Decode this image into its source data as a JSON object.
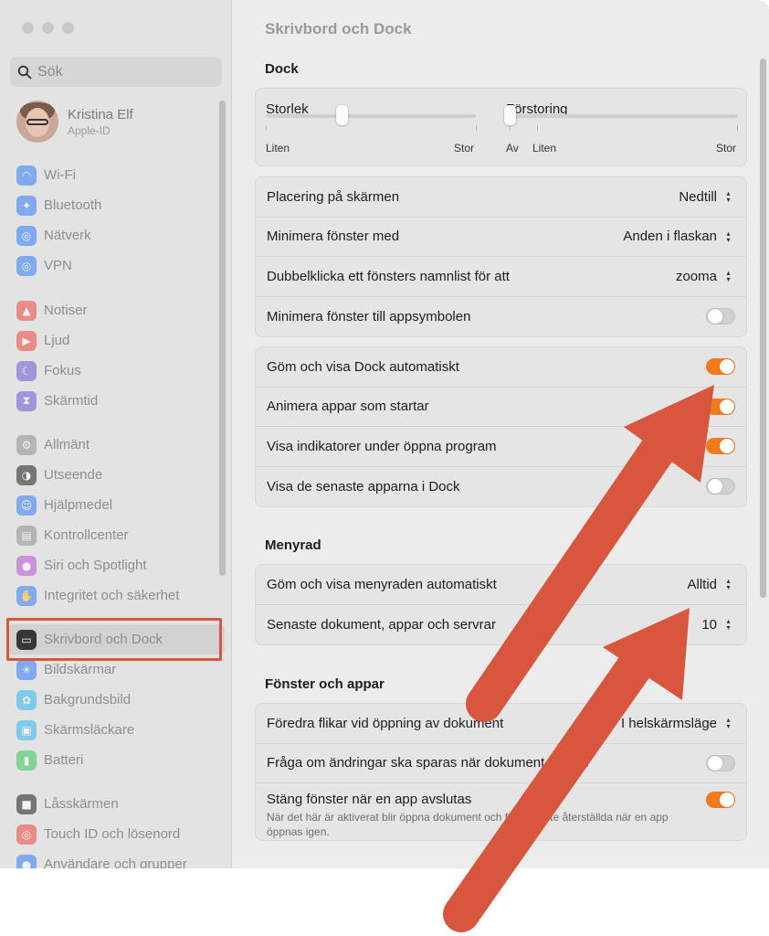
{
  "window": {
    "title": "Skrivbord och Dock"
  },
  "search": {
    "placeholder": "Sök"
  },
  "profile": {
    "name": "Kristina Elf",
    "subtitle": "Apple-ID"
  },
  "sidebar": {
    "group1": [
      {
        "label": "Wi-Fi",
        "icon": "wifi-icon",
        "color": "#2f7cf6"
      },
      {
        "label": "Bluetooth",
        "icon": "bluetooth-icon",
        "color": "#2f7cf6"
      },
      {
        "label": "Nätverk",
        "icon": "globe-icon",
        "color": "#2f7cf6"
      },
      {
        "label": "VPN",
        "icon": "vpn-globe-icon",
        "color": "#2f7cf6"
      }
    ],
    "group2": [
      {
        "label": "Notiser",
        "icon": "bell-icon",
        "color": "#f0453a"
      },
      {
        "label": "Ljud",
        "icon": "speaker-icon",
        "color": "#f0453a"
      },
      {
        "label": "Fokus",
        "icon": "moon-icon",
        "color": "#6b55d6"
      },
      {
        "label": "Skärmtid",
        "icon": "hourglass-icon",
        "color": "#6b55d6"
      }
    ],
    "group3": [
      {
        "label": "Allmänt",
        "icon": "gear-icon",
        "color": "#8e8e93"
      },
      {
        "label": "Utseende",
        "icon": "appearance-icon",
        "color": "#1d1d1f"
      },
      {
        "label": "Hjälpmedel",
        "icon": "accessibility-icon",
        "color": "#2f7cf6"
      },
      {
        "label": "Kontrollcenter",
        "icon": "control-center-icon",
        "color": "#8e8e93"
      },
      {
        "label": "Siri och Spotlight",
        "icon": "siri-icon",
        "color": "#b84fd6"
      },
      {
        "label": "Integritet och säkerhet",
        "icon": "hand-icon",
        "color": "#2f7cf6"
      }
    ],
    "group4": [
      {
        "label": "Skrivbord och Dock",
        "icon": "dock-icon",
        "color": "#1d1d1f",
        "active": true
      },
      {
        "label": "Bildskärmar",
        "icon": "display-icon",
        "color": "#2f7cf6"
      },
      {
        "label": "Bakgrundsbild",
        "icon": "wallpaper-icon",
        "color": "#2fb6f0"
      },
      {
        "label": "Skärmsläckare",
        "icon": "screensaver-icon",
        "color": "#2fb6f0"
      },
      {
        "label": "Batteri",
        "icon": "battery-icon",
        "color": "#34c759"
      }
    ],
    "group5": [
      {
        "label": "Låsskärmen",
        "icon": "lock-icon",
        "color": "#1d1d1f"
      },
      {
        "label": "Touch ID och lösenord",
        "icon": "fingerprint-icon",
        "color": "#f0453a"
      },
      {
        "label": "Användare och grupper",
        "icon": "users-icon",
        "color": "#2f7cf6"
      }
    ]
  },
  "sections": {
    "dock": "Dock",
    "menubar": "Menyrad",
    "windows": "Fönster och appar"
  },
  "sliders": {
    "size": {
      "label": "Storlek",
      "min": "Liten",
      "max": "Stor",
      "value": 0.36
    },
    "magnification": {
      "label": "Förstoring",
      "off": "Av",
      "min": "Liten",
      "max": "Stor",
      "value": 0.0
    }
  },
  "dock_rows": [
    {
      "label": "Placering på skärmen",
      "value": "Nedtill"
    },
    {
      "label": "Minimera fönster med",
      "value": "Anden i flaskan"
    },
    {
      "label": "Dubbelklicka ett fönsters namnlist för att",
      "value": "zooma"
    },
    {
      "label": "Minimera fönster till appsymbolen",
      "toggle": false
    }
  ],
  "dock_toggles": [
    {
      "label": "Göm och visa Dock automatiskt",
      "toggle": true
    },
    {
      "label": "Animera appar som startar",
      "toggle": true
    },
    {
      "label": "Visa indikatorer under öppna program",
      "toggle": true
    },
    {
      "label": "Visa de senaste apparna i Dock",
      "toggle": false
    }
  ],
  "menubar_rows": [
    {
      "label": "Göm och visa menyraden automatiskt",
      "value": "Alltid"
    },
    {
      "label": "Senaste dokument, appar och servrar",
      "value": "10"
    }
  ],
  "window_rows": [
    {
      "label": "Föredra flikar vid öppning av dokument",
      "value": "I helskärmsläge"
    },
    {
      "label": "Fråga om ändringar ska sparas när dokument stängs",
      "toggle": false
    },
    {
      "label": "Stäng fönster när en app avslutas",
      "toggle": true,
      "subtitle": "När det här är aktiverat blir öppna dokument och fönster inte återställda när en app öppnas igen."
    }
  ],
  "colors": {
    "accent": "#f07a1c",
    "annotation": "#d9563e"
  }
}
